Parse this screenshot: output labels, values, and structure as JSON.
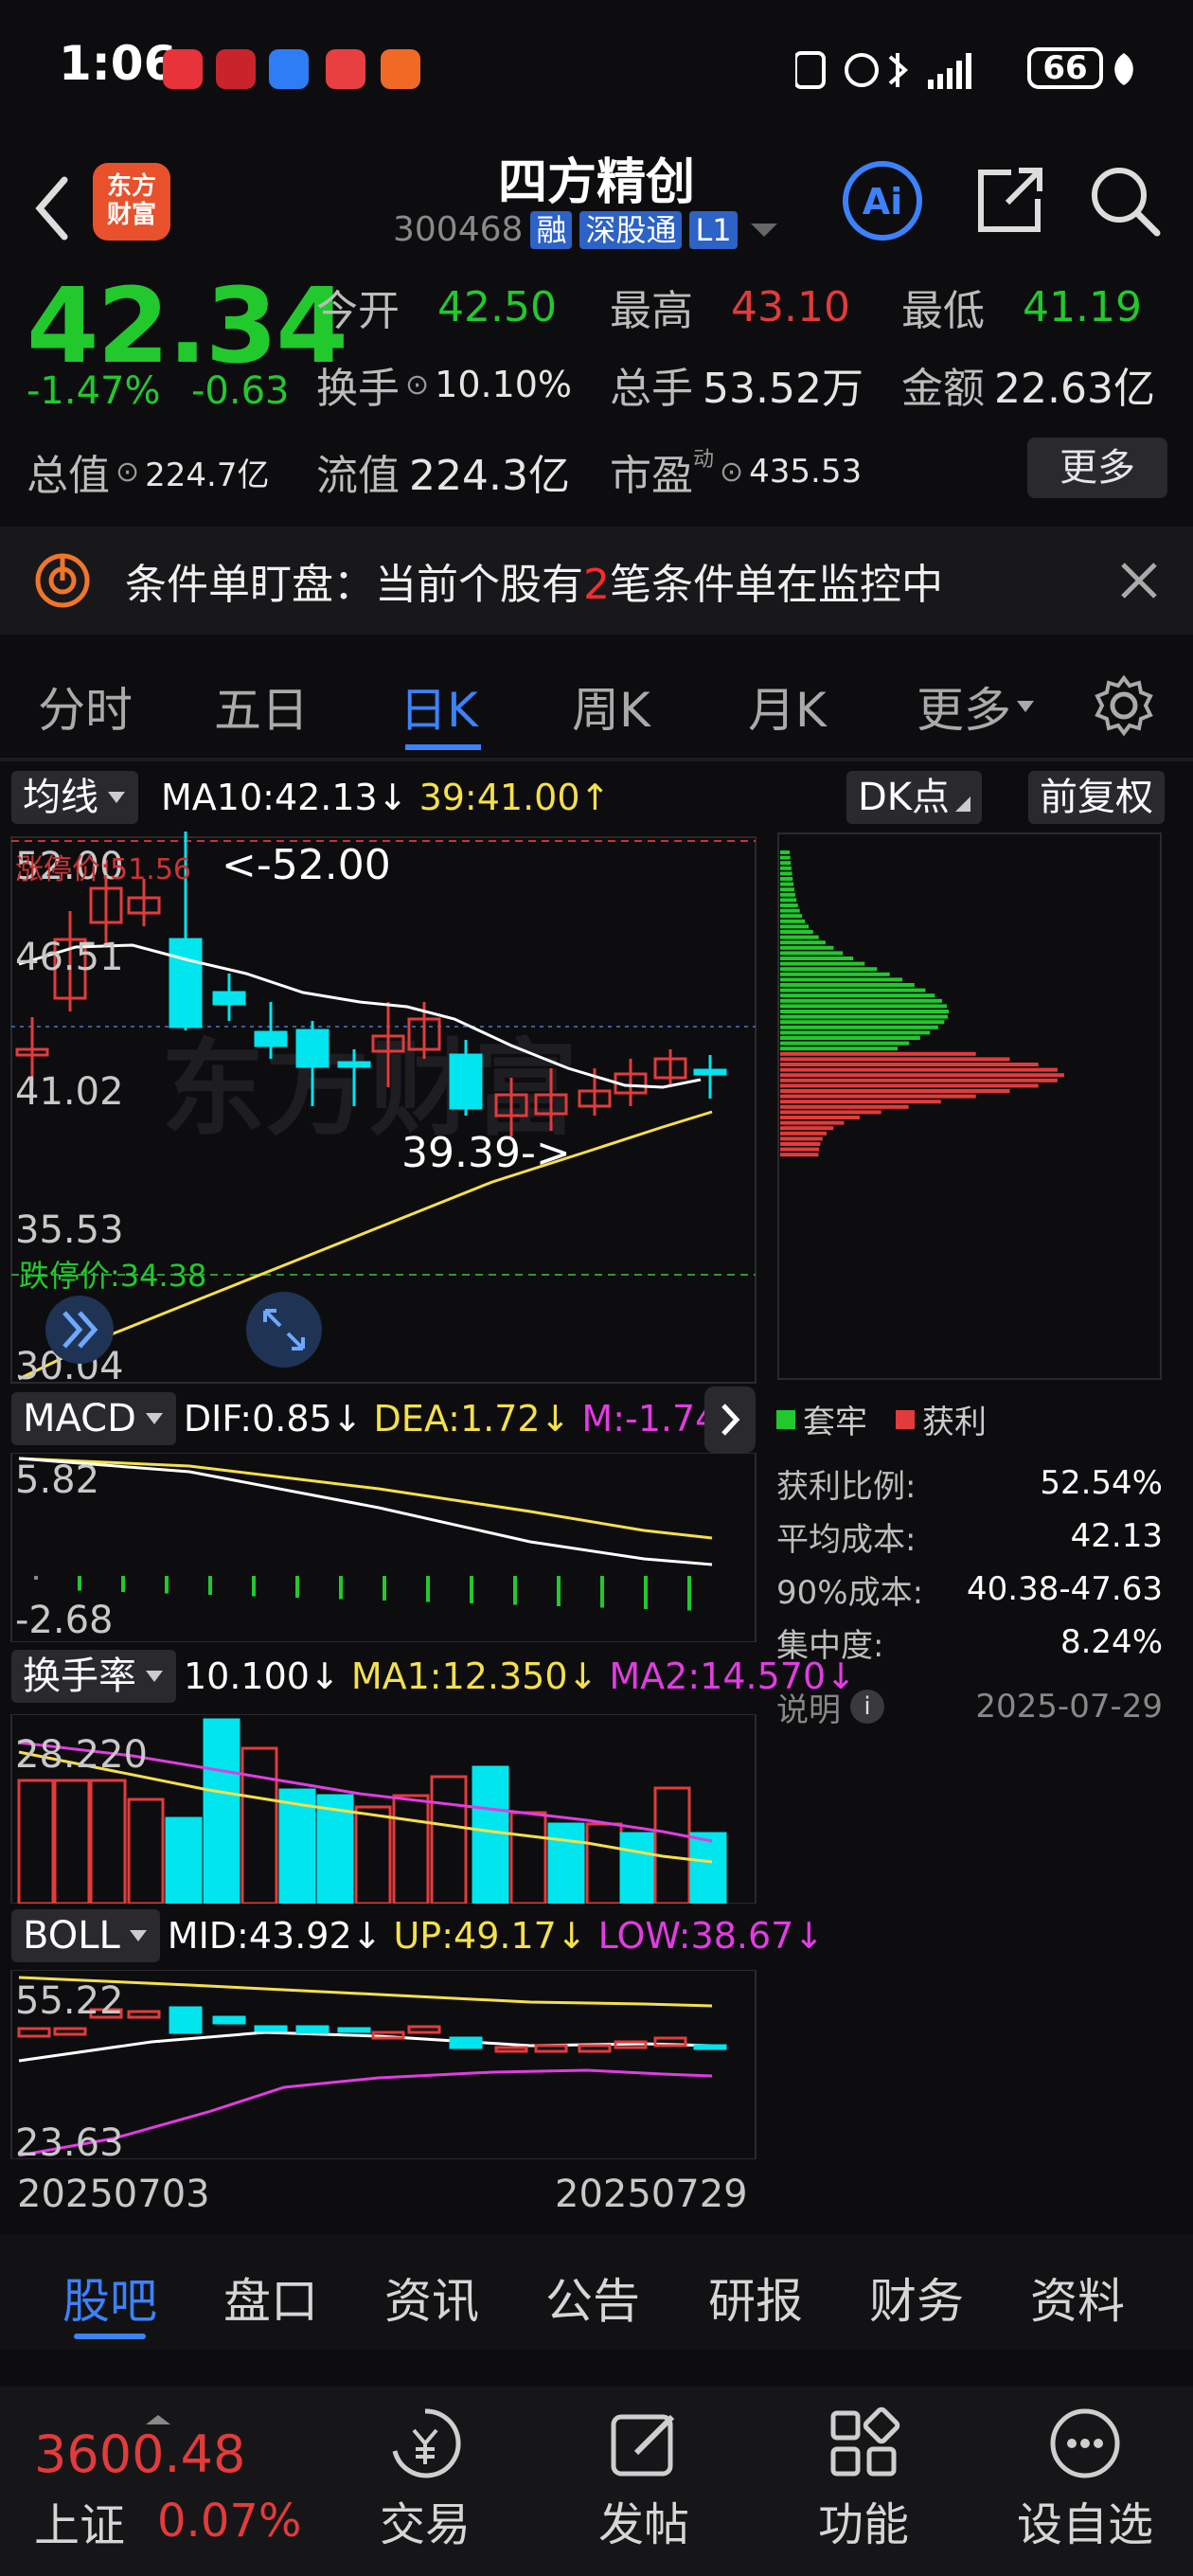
{
  "status_bar": {
    "time": "1:06",
    "battery": "66"
  },
  "header": {
    "logo_line1": "东方",
    "logo_line2": "财富",
    "stock_name": "四方精创",
    "stock_code": "300468",
    "tags": [
      "融",
      "深股通",
      "L1"
    ]
  },
  "quote": {
    "price": "42.34",
    "change_pct": "-1.47%",
    "change_abs": "-0.63",
    "open_label": "今开",
    "open_value": "42.50",
    "high_label": "最高",
    "high_value": "43.10",
    "low_label": "最低",
    "low_value": "41.19",
    "turnover_label": "换手",
    "turnover_value": "10.10%",
    "volume_label": "总手",
    "volume_value": "53.52万",
    "amount_label": "金额",
    "amount_value": "22.63亿",
    "mktcap_label": "总值",
    "mktcap_value": "224.7亿",
    "float_label": "流值",
    "float_value": "224.3亿",
    "pe_label": "市盈",
    "pe_sup": "动",
    "pe_value": "435.53",
    "more_label": "更多"
  },
  "banner": {
    "prefix": "条件单盯盘：当前个股有",
    "count": "2",
    "suffix": "笔条件单在监控中"
  },
  "tabs": [
    "分时",
    "五日",
    "日K",
    "周K",
    "月K",
    "更多"
  ],
  "active_tab": "日K",
  "kline": {
    "ma_selector": "均线",
    "ma10": "MA10:42.13↓",
    "ma39": "39:41.00↑",
    "dk_label": "DK点",
    "adjust_label": "前复权",
    "y_labels": [
      "52.00",
      "46.51",
      "41.02",
      "35.53",
      "30.04"
    ],
    "limit_up": "涨停价:51.56",
    "limit_down": "跌停价:34.38",
    "high_marker": "<-52.00",
    "low_marker": "39.39->"
  },
  "macd": {
    "selector": "MACD",
    "dif": "DIF:0.85↓",
    "dea": "DEA:1.72↓",
    "m": "M:-1.74↑",
    "top": "5.82",
    "bottom": "-2.68"
  },
  "turnover": {
    "selector": "换手率",
    "value": "10.100↓",
    "ma1": "MA1:12.350↓",
    "ma2": "MA2:14.570↓",
    "top": "28.220"
  },
  "boll": {
    "selector": "BOLL",
    "mid": "MID:43.92↓",
    "up": "UP:49.17↓",
    "low": "LOW:38.67↓",
    "top": "55.22",
    "bottom": "23.63"
  },
  "dates": {
    "start": "20250703",
    "end": "20250729"
  },
  "chip": {
    "legend_hold": "套牢",
    "legend_profit": "获利",
    "rows": [
      {
        "label": "获利比例:",
        "value": "52.54%"
      },
      {
        "label": "平均成本:",
        "value": "42.13"
      },
      {
        "label": "90%成本:",
        "value": "40.38-47.63"
      },
      {
        "label": "集中度:",
        "value": "8.24%"
      }
    ],
    "note_label": "说明",
    "note_date": "2025-07-29"
  },
  "subtabs": [
    "股吧",
    "盘口",
    "资讯",
    "公告",
    "研报",
    "财务",
    "资料"
  ],
  "active_subtab": "股吧",
  "bottom": {
    "index_value": "3600.48",
    "index_name": "上证",
    "index_change": "0.07%",
    "items": [
      "交易",
      "发帖",
      "功能",
      "设自选"
    ]
  },
  "colors": {
    "up": "#e33b3b",
    "down": "#21c92d",
    "accent": "#3c82ff",
    "cyan": "#00e5ee",
    "yellow": "#f5e04a",
    "magenta": "#e23ce2"
  }
}
